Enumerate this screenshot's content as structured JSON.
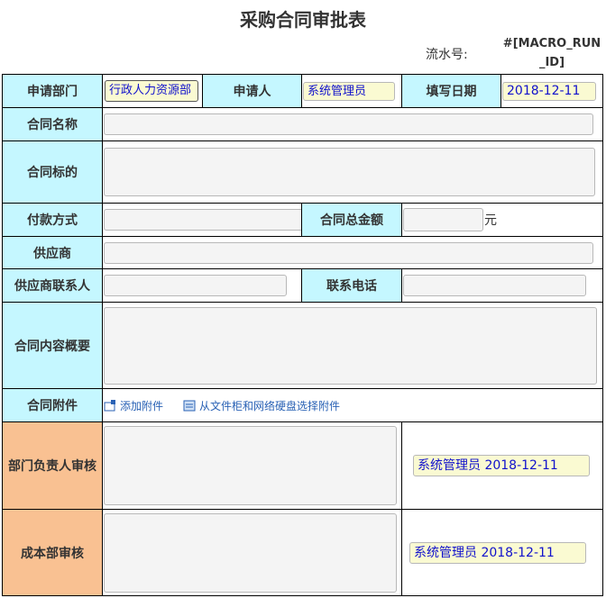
{
  "title": "采购合同审批表",
  "serial": {
    "label": "流水号:",
    "value": "#[MACRO_RUN_ID]"
  },
  "form": {
    "dept_label": "申请部门",
    "dept_value": "行政人力资源部",
    "applicant_label": "申请人",
    "applicant_value": "系统管理员",
    "date_label": "填写日期",
    "date_value": "2018-12-11",
    "contract_name_label": "合同名称",
    "contract_subject_label": "合同标的",
    "payment_label": "付款方式",
    "amount_label": "合同总金额",
    "amount_unit": "元",
    "supplier_label": "供应商",
    "supplier_contact_label": "供应商联系人",
    "phone_label": "联系电话",
    "summary_label": "合同内容概要",
    "attachment_label": "合同附件",
    "add_attachment": "添加附件",
    "select_attachment": "从文件柜和网络硬盘选择附件",
    "dept_review_label": "部门负责人审核",
    "dept_review_sign": "系统管理员 2018-12-11",
    "cost_review_label": "成本部审核",
    "cost_review_sign": "系统管理员 2018-12-11"
  },
  "colors": {
    "label_bg": "#c5f7ff",
    "review_label_bg": "#f9c192",
    "readonly_bg": "#fafad2",
    "readonly_text": "#1111cc"
  }
}
